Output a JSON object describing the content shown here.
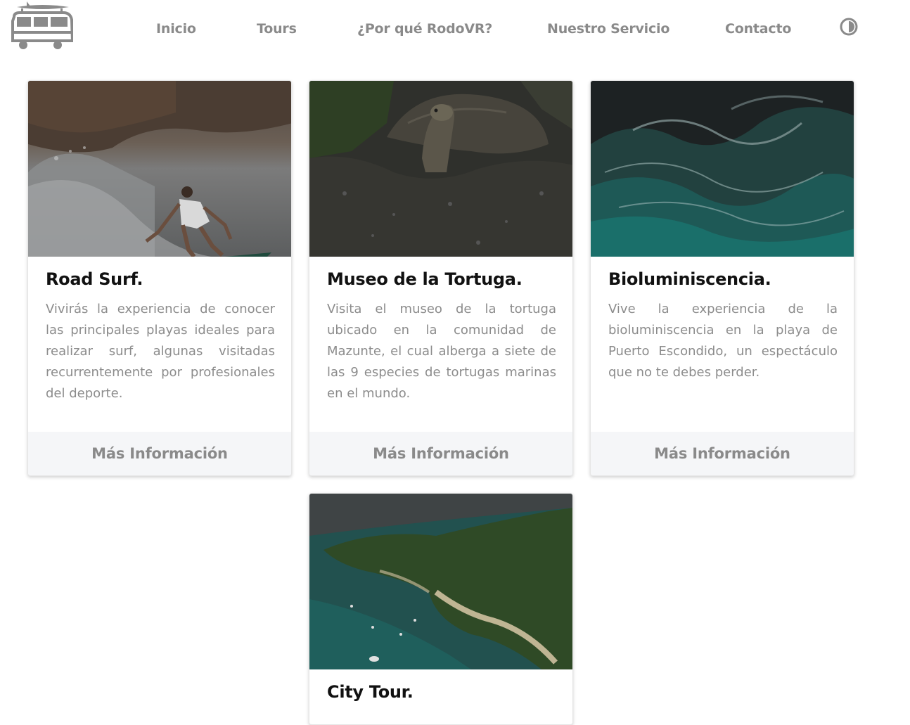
{
  "nav": {
    "links": [
      "Inicio",
      "Tours",
      "¿Por qué RodoVR?",
      "Nuestro Servicio",
      "Contacto"
    ]
  },
  "icons": {
    "logo": "van-surfboard-logo",
    "theme": "contrast-toggle-icon"
  },
  "cards": [
    {
      "title": "Road Surf.",
      "text": "Vivirás la experiencia de conocer las principales playas ideales para realizar surf, algunas visitadas recurrentemente por profesionales del deporte.",
      "button": "Más Información"
    },
    {
      "title": "Museo de la Tortuga.",
      "text": "Visita el museo de la tortuga ubicado en la comunidad de Mazunte, el cual alberga a siete de las 9 especies de tortugas marinas en el mundo.",
      "button": "Más Información"
    },
    {
      "title": "Bioluminiscencia.",
      "text": "Vive la experiencia de la bioluminiscencia en la playa de Puerto Escondido, un espectáculo que no te debes perder.",
      "button": "Más Información"
    },
    {
      "title": "City Tour."
    }
  ],
  "colors": {
    "nav_text": "#8a8a8a",
    "body_text": "#8c8c8c",
    "footer_bg": "#f5f6f8"
  }
}
